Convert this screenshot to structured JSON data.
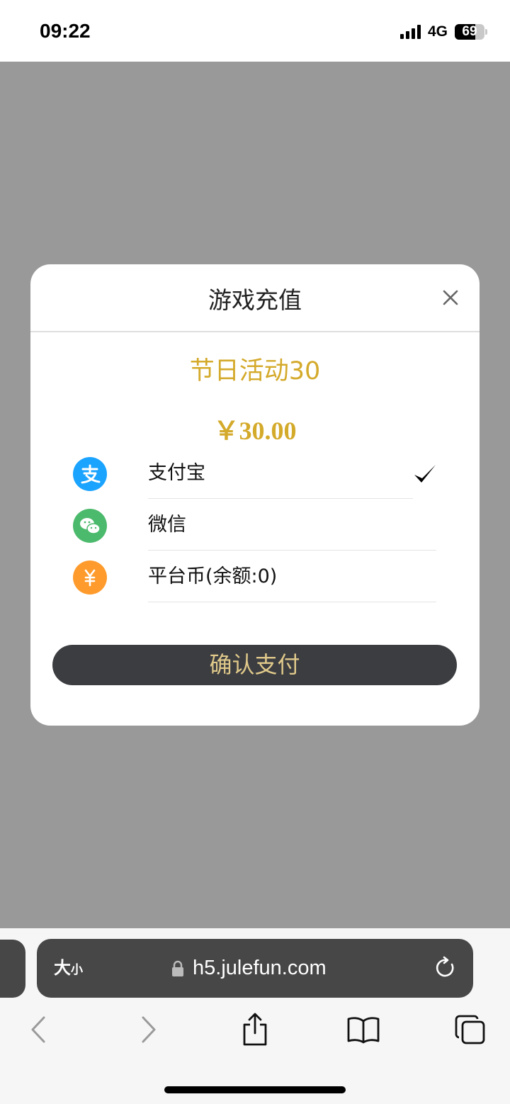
{
  "status_bar": {
    "time": "09:22",
    "network": "4G",
    "battery_level": "69"
  },
  "modal": {
    "title": "游戏充值",
    "product_name": "节日活动30",
    "price": "￥30.00",
    "payment_methods": [
      {
        "label": "支付宝",
        "icon": "alipay-icon",
        "selected": true,
        "color": "#1aa3ff"
      },
      {
        "label": "微信",
        "icon": "wechat-icon",
        "selected": false,
        "color": "#4cba6c"
      },
      {
        "label": "平台币(余额:0)",
        "icon": "platform-coin-icon",
        "selected": false,
        "color": "#ff9b2c"
      }
    ],
    "confirm_label": "确认支付"
  },
  "browser": {
    "text_size_big": "大",
    "text_size_small": "小",
    "url": "h5.julefun.com"
  },
  "colors": {
    "accent_gold": "#d4aa2b",
    "button_dark": "#3c3d41",
    "overlay": "#999999"
  }
}
